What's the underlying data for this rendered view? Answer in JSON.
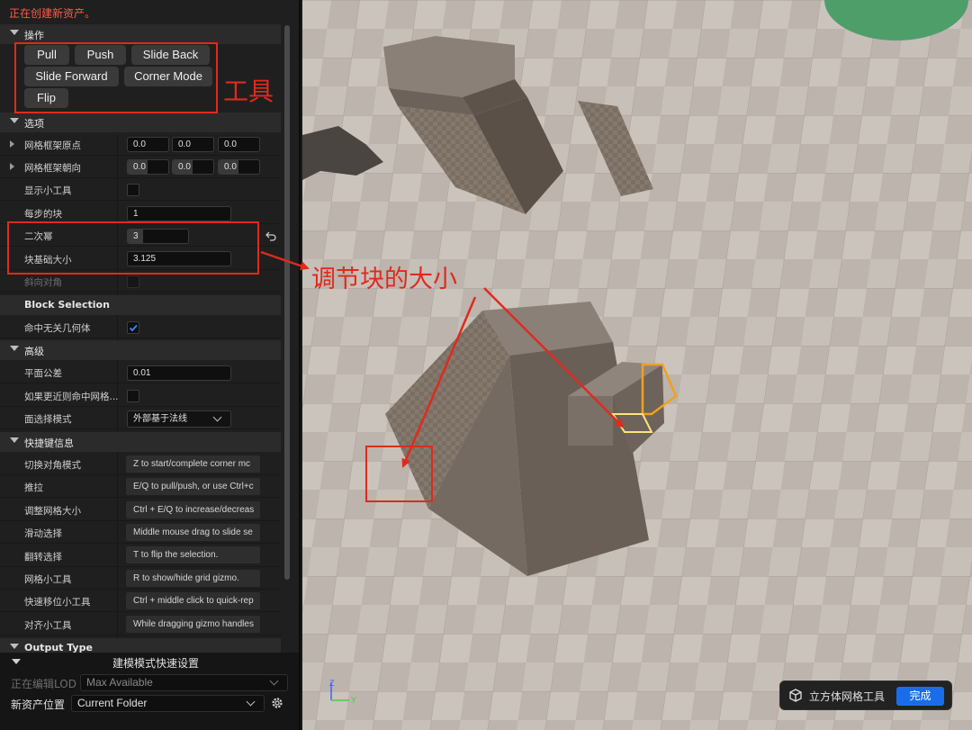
{
  "status": "正在创建新资产。",
  "sections": {
    "operations": "操作",
    "options": "选项",
    "block_selection": "Block Selection",
    "advanced": "高级",
    "shortcuts": "快捷键信息",
    "output_type": "Output Type"
  },
  "tool_buttons": {
    "pull": "Pull",
    "push": "Push",
    "slide_back": "Slide Back",
    "slide_forward": "Slide Forward",
    "corner_mode": "Corner Mode",
    "flip": "Flip"
  },
  "options": {
    "grid_origin": {
      "label": "网格框架原点",
      "values": [
        "0.0",
        "0.0",
        "0.0"
      ]
    },
    "grid_orientation": {
      "label": "网格框架朝向",
      "values": [
        "0.0",
        "0.0",
        "0.0"
      ]
    },
    "show_gizmo": {
      "label": "显示小工具",
      "checked": false
    },
    "blocks_per_step": {
      "label": "每步的块",
      "value": "1"
    },
    "power_of_two": {
      "label": "二次幂",
      "value": "3"
    },
    "block_base_size": {
      "label": "块基础大小",
      "value": "3.125"
    },
    "diagonal": {
      "label": "斜向对角"
    }
  },
  "block_selection": {
    "hit_unrelated": {
      "label": "命中无关几何体",
      "checked": true
    }
  },
  "advanced": {
    "plane_tolerance": {
      "label": "平面公差",
      "value": "0.01"
    },
    "hit_grid_if_closer": {
      "label": "如果更近则命中网格...",
      "checked": false
    },
    "face_select_mode": {
      "label": "面选择模式",
      "value": "外部基于法线"
    }
  },
  "shortcuts": [
    {
      "label": "切换对角模式",
      "hint": "Z to start/complete corner mc"
    },
    {
      "label": "推拉",
      "hint": "E/Q to pull/push, or use Ctrl+c"
    },
    {
      "label": "调整网格大小",
      "hint": "Ctrl + E/Q to increase/decreas"
    },
    {
      "label": "滑动选择",
      "hint": "Middle mouse drag to slide se"
    },
    {
      "label": "翻转选择",
      "hint": "T to flip the selection."
    },
    {
      "label": "网格小工具",
      "hint": "R to show/hide grid gizmo."
    },
    {
      "label": "快速移位小工具",
      "hint": "Ctrl + middle click to quick-rep"
    },
    {
      "label": "对齐小工具",
      "hint": "While dragging gizmo handles"
    }
  ],
  "quick_settings": {
    "title": "建模模式快速设置",
    "lod_label": "正在编辑LOD",
    "lod_value": "Max Available",
    "location_label": "新资产位置",
    "location_value": "Current Folder"
  },
  "tool_pill": {
    "name": "立方体网格工具",
    "done": "完成"
  },
  "annotations": {
    "tools": "工具",
    "block_size": "调节块的大小"
  },
  "axis": {
    "z": "Z",
    "y": "Y"
  },
  "colors": {
    "accent": "#1a6de8",
    "annotation_red": "#e02a1d",
    "status_red": "#ff5a4d"
  }
}
